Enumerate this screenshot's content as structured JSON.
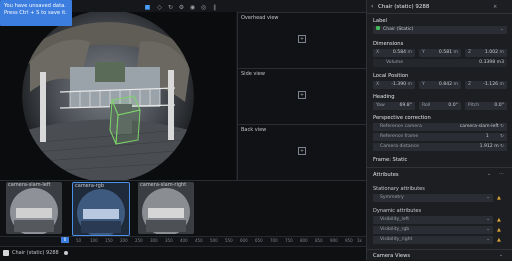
{
  "toast": {
    "line1": "You have unsaved data.",
    "line2": "Press Ctrl + S to save it."
  },
  "toolbar": {
    "icons": [
      "video-icon",
      "cube-icon",
      "rotate-icon",
      "settings-icon",
      "camera-icon",
      "target-icon",
      "pause-icon"
    ]
  },
  "side_views": [
    {
      "label": "Overhead view"
    },
    {
      "label": "Side view"
    },
    {
      "label": "Back view"
    }
  ],
  "cameras": [
    {
      "label": "camera-slam-left"
    },
    {
      "label": "camera-rgb"
    },
    {
      "label": "camera-slam-right"
    }
  ],
  "timeline": {
    "playhead": "0",
    "ticks": [
      "50",
      "100",
      "150",
      "200",
      "250",
      "300",
      "350",
      "400",
      "450",
      "500",
      "550",
      "600",
      "650",
      "700",
      "750",
      "800",
      "850",
      "900",
      "950",
      "1k"
    ]
  },
  "status": {
    "item": "Chair (static) 9288"
  },
  "panel": {
    "title": "Chair (static) 9288",
    "label_section": "Label",
    "label_value": "Chair (Static)",
    "dimensions_section": "Dimensions",
    "dims": [
      {
        "axis": "X",
        "value": "0.584",
        "unit": "m"
      },
      {
        "axis": "Y",
        "value": "0.581",
        "unit": "m"
      },
      {
        "axis": "Z",
        "value": "1.002",
        "unit": "m"
      }
    ],
    "volume_label": "Volume",
    "volume_value": "0.3398 m3",
    "local_position_section": "Local Position",
    "pos": [
      {
        "axis": "X",
        "value": "-1.390",
        "unit": "m"
      },
      {
        "axis": "Y",
        "value": "0.842",
        "unit": "m"
      },
      {
        "axis": "Z",
        "value": "-1.126",
        "unit": "m"
      }
    ],
    "heading_section": "Heading",
    "heading": [
      {
        "axis": "Yaw",
        "value": "69.8°"
      },
      {
        "axis": "Roll",
        "value": "0.0°"
      },
      {
        "axis": "Pitch",
        "value": "0.0°"
      }
    ],
    "perspective_section": "Perspective correction",
    "ref_camera_label": "Reference camera",
    "ref_camera_value": "camera-slam-left",
    "ref_frame_label": "Reference frame",
    "ref_frame_value": "1",
    "cam_distance_label": "Camera distance",
    "cam_distance_value": "1.912 m",
    "frame_label": "Frame: Static",
    "attributes_section": "Attributes",
    "stationary_section": "Stationary attributes",
    "stationary_items": [
      "Symmetry"
    ],
    "dynamic_section": "Dynamic attributes",
    "dynamic_items": [
      "Visibility_left",
      "Visibility_rgb",
      "Visibility_right"
    ],
    "camera_views_section": "Camera Views"
  },
  "colors": {
    "accent": "#3c7de0",
    "box": "#7ed36b",
    "label_dot": "#45b85a"
  }
}
